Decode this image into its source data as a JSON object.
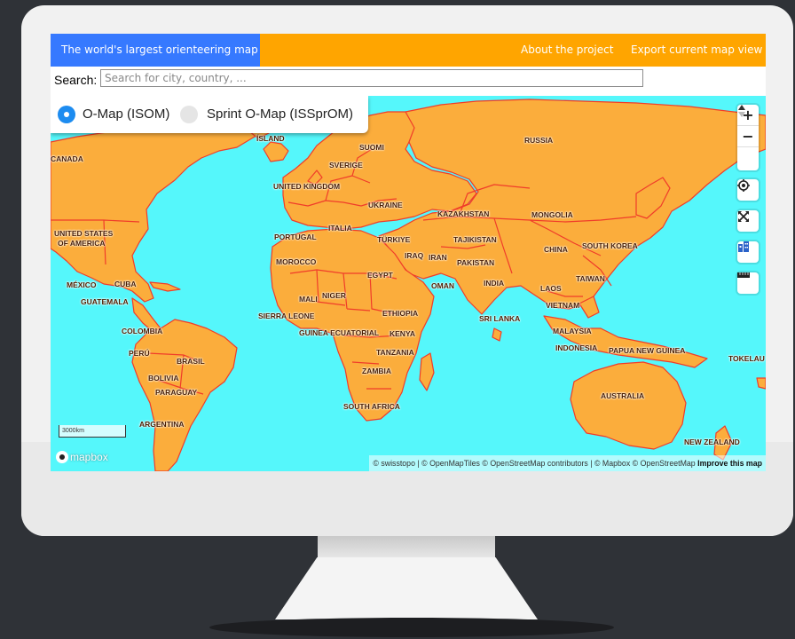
{
  "nav": {
    "title": "The world's largest orienteering map",
    "about": "About the project",
    "export": "Export current map view"
  },
  "search": {
    "label": "Search:",
    "placeholder": "Search for city, country, ..."
  },
  "map_toggle": {
    "option1": "O-Map (ISOM)",
    "option2": "Sprint O-Map (ISSprOM)",
    "selected": "O-Map (ISOM)"
  },
  "controls": {
    "zoom_in": "+",
    "zoom_out": "−",
    "icons": [
      "zoom-in-icon",
      "zoom-out-icon",
      "compass-icon",
      "locate-icon",
      "fullscreen-icon",
      "buildings-icon",
      "ruler-icon"
    ]
  },
  "map": {
    "scale": "3000km",
    "logo": "mapbox",
    "attribution": "© swisstopo | © OpenMapTiles © OpenStreetMap contributors | © Mapbox © OpenStreetMap",
    "improve": "Improve this map",
    "labels": {
      "canada": "CANADA",
      "united_states": "UNITED STATES",
      "of_america": "OF AMERICA",
      "mexico": "MÉXICO",
      "cuba": "CUBA",
      "guatemala": "GUATEMALA",
      "colombia": "COLOMBIA",
      "peru": "PERÚ",
      "brasil": "BRASIL",
      "bolivia": "BOLIVIA",
      "paraguay": "PARAGUAY",
      "argentina": "ARGENTINA",
      "island": "ÍSLAND",
      "suomi": "SUOMI",
      "sverige": "SVERIGE",
      "united_kingdom": "UNITED KINGDOM",
      "ukraine": "UKRAINE",
      "portugal": "PORTUGAL",
      "italia": "ITALIA",
      "turkiye": "TÜRKIYE",
      "morocco": "MOROCCO",
      "iraq": "IRAQ",
      "iran": "IRAN",
      "egypt": "EGYPT",
      "mali": "MALI",
      "niger": "NIGER",
      "sierra_leone": "SIERRA LEONE",
      "ethiopia": "ETHIOPIA",
      "guinea_ecuatorial": "GUINEA ECUATORIAL",
      "kenya": "KENYA",
      "tanzania": "TANZANIA",
      "zambia": "ZAMBIA",
      "south_africa": "SOUTH AFRICA",
      "russia": "RUSSIA",
      "kazakhstan": "KAZAKHSTAN",
      "mongolia": "MONGOLIA",
      "tajikistan": "TAJIKISTAN",
      "pakistan": "PAKISTAN",
      "china": "CHINA",
      "south_korea": "SOUTH KOREA",
      "oman": "OMAN",
      "india": "INDIA",
      "taiwan": "TAIWAN",
      "laos": "LAOS",
      "vietnam": "VIETNAM",
      "sri_lanka": "SRI LANKA",
      "malaysia": "MALAYSIA",
      "indonesia": "INDONESIA",
      "papua_new_guinea": "PAPUA NEW GUINEA",
      "tokelau": "TOKELAU",
      "australia": "AUSTRALIA",
      "new_zealand": "NEW ZEALAND"
    }
  },
  "colors": {
    "nav_orange": "#ffa500",
    "nav_blue": "#3679ff",
    "ocean": "#55f7fb",
    "land": "#fbad3c",
    "border": "#f03c2a",
    "radio_selected": "#1d8cf0"
  }
}
